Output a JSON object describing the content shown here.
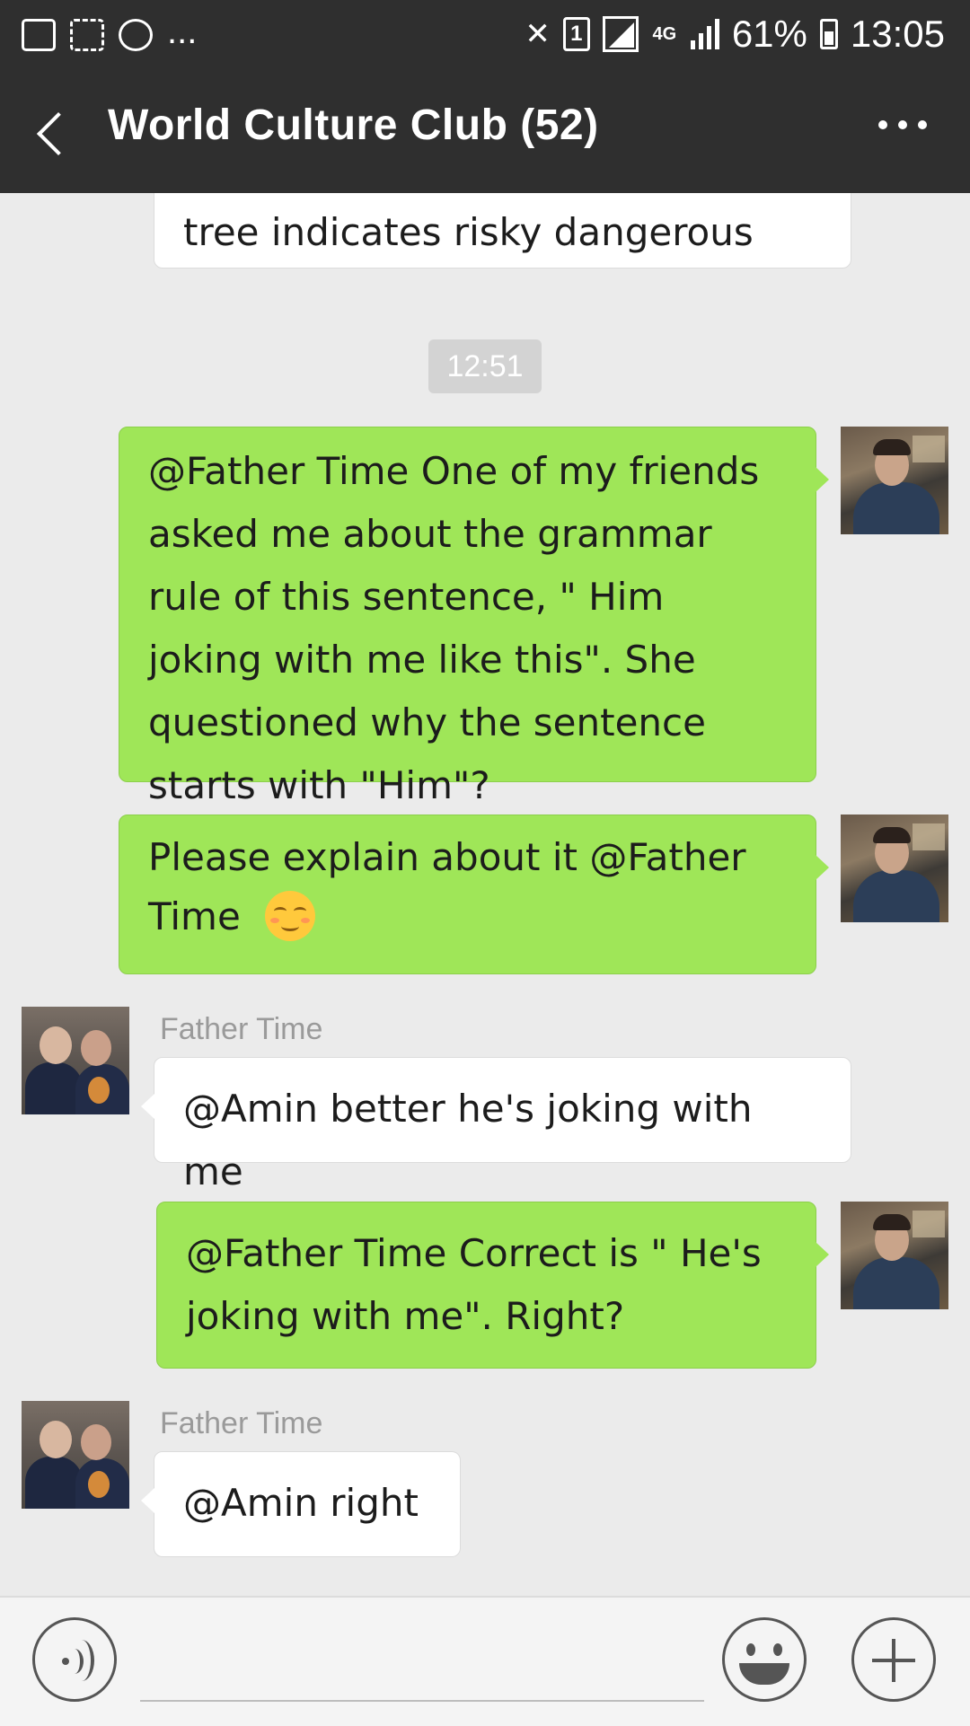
{
  "status_bar": {
    "sim_slot": "1",
    "network_type": "4G",
    "battery": "61%",
    "time": "13:05",
    "overflow": "..."
  },
  "header": {
    "title": "World Culture Club (52)",
    "back_icon": "chevron-left-icon",
    "more_icon": "more-dots-icon"
  },
  "messages": [
    {
      "type": "incoming",
      "text": "tree indicates risky dangerous"
    },
    {
      "type": "timestamp",
      "text": "12:51"
    },
    {
      "type": "outgoing",
      "text": "@Father Time  One of my friends asked me about the grammar rule of this sentence, \" Him joking with me like this\". She questioned why the sentence starts with \"Him\"?"
    },
    {
      "type": "outgoing",
      "text": "Please explain about it @Father Time ",
      "emoji": "smiling-face-emoji"
    },
    {
      "type": "incoming",
      "sender": "Father Time",
      "text": "@Amin better he's joking with me"
    },
    {
      "type": "outgoing",
      "text": "@Father Time  Correct is \" He's joking with me\". Right?"
    },
    {
      "type": "incoming",
      "sender": "Father Time",
      "text": "@Amin  right"
    }
  ],
  "input_bar": {
    "voice_icon": "voice-icon",
    "input_value": "",
    "emoji_icon": "emoji-icon",
    "plus_icon": "plus-icon"
  },
  "colors": {
    "header_bg": "#2f2f2f",
    "chat_bg": "#ebebeb",
    "outgoing_bubble": "#9fe658",
    "incoming_bubble": "#ffffff"
  }
}
